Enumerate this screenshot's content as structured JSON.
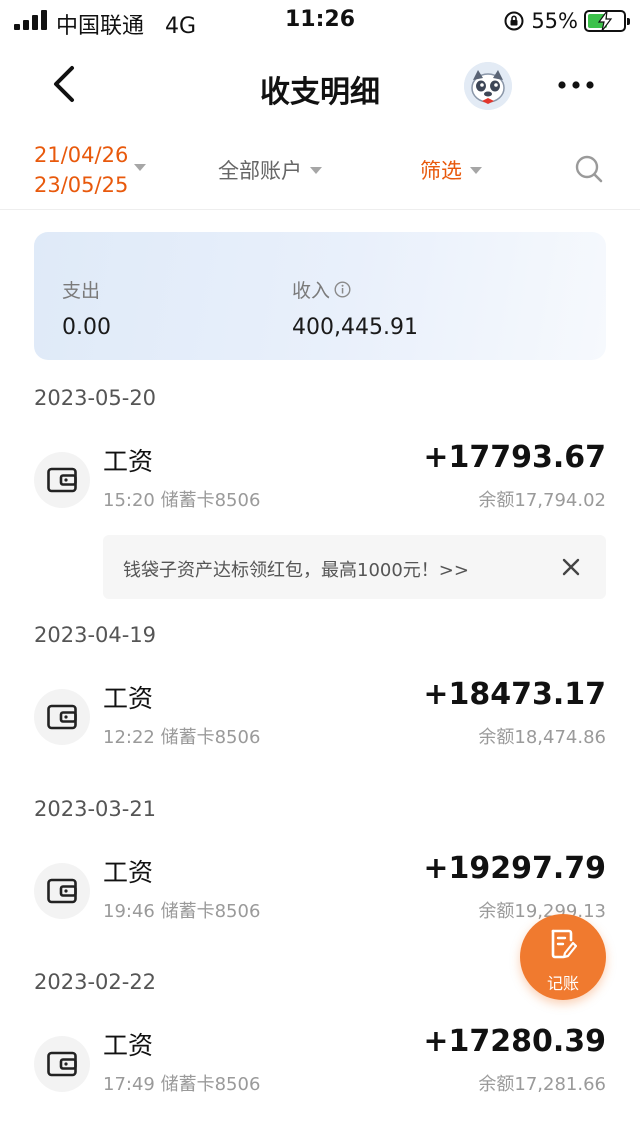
{
  "status_bar": {
    "carrier": "中国联通",
    "network": "4G",
    "time": "11:26",
    "battery_percent": "55%",
    "battery_level": 0.55
  },
  "nav": {
    "title": "收支明细",
    "back_icon": "chevron-left-icon",
    "more_icon": "more-dots-icon"
  },
  "filters": {
    "date_start": "21/04/26",
    "date_end": "23/05/25",
    "accounts": "全部账户",
    "screen": "筛选",
    "accent_color": "#e8590c"
  },
  "summary": {
    "expense_label": "支出",
    "expense_value": "0.00",
    "income_label": "收入",
    "income_value": "400,445.91"
  },
  "groups": [
    {
      "date": "2023-05-20",
      "title": "工资",
      "meta": "15:20 储蓄卡8506",
      "amount": "+17793.67",
      "balance": "余额17,794.02"
    },
    {
      "date": "2023-04-19",
      "title": "工资",
      "meta": "12:22 储蓄卡8506",
      "amount": "+18473.17",
      "balance": "余额18,474.86"
    },
    {
      "date": "2023-03-21",
      "title": "工资",
      "meta": "19:46 储蓄卡8506",
      "amount": "+19297.79",
      "balance": "余额19,299.13"
    },
    {
      "date": "2023-02-22",
      "title": "工资",
      "meta": "17:49 储蓄卡8506",
      "amount": "+17280.39",
      "balance": "余额17,281.66"
    }
  ],
  "promo": {
    "text": "钱袋子资产达标领红包，最高1000元！>>"
  },
  "fab": {
    "label": "记账",
    "color": "#f07a2f"
  }
}
